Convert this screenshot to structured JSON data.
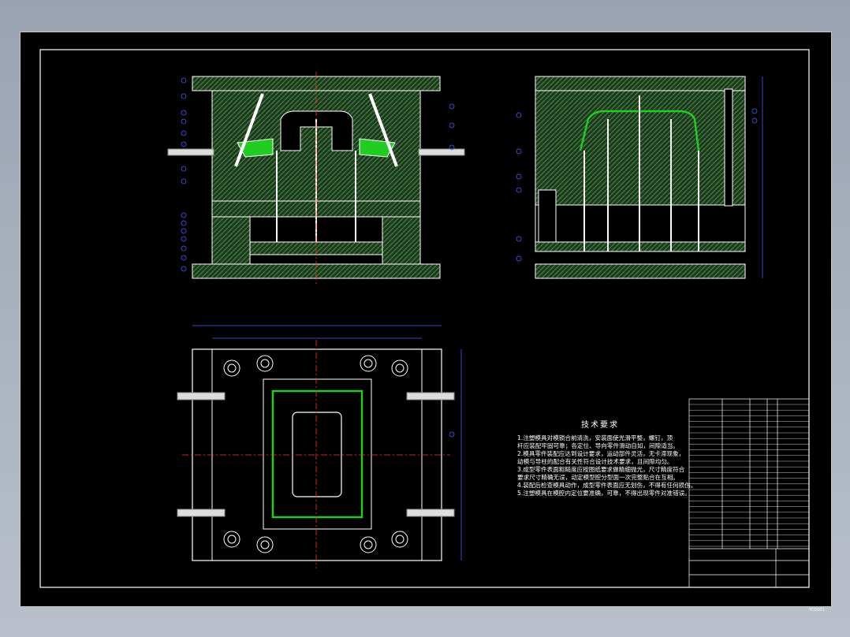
{
  "tech_requirements": {
    "title": "技术要求",
    "lines": [
      "1.注塑模具对模锁合前清洗，安装面使光滑平整，螺钉，顶",
      "  杆应装配牢固可靠；各定位、导向零件滑动自如，间隙适当。",
      "2.模具零件装配应达到设计要求，运动部件灵活，无卡滞现象，",
      "  动模与导柱的配合有关性符合设计技术要求，且间隙均匀。",
      "3.成型零件表面粗糙度应按图纸要求做精细抛光，尺寸精度符合",
      "  要求尺寸精确无误，动定模型腔分型面一次完整贴合在互相。",
      "4.装配后检查模具动作，成型零件表面应无划伤，不得有任何损伤。",
      "5.注塑模具在模腔内定位要准确，可靠，不得出现零件对准错误。"
    ]
  },
  "drawing_number": "YCD001",
  "colors": {
    "background": "#000000",
    "outline": "#ffffff",
    "hatch": "#2f5f2f",
    "part": "#22cc22",
    "dimension": "#4a5cff",
    "center_line": "#ff3333"
  }
}
